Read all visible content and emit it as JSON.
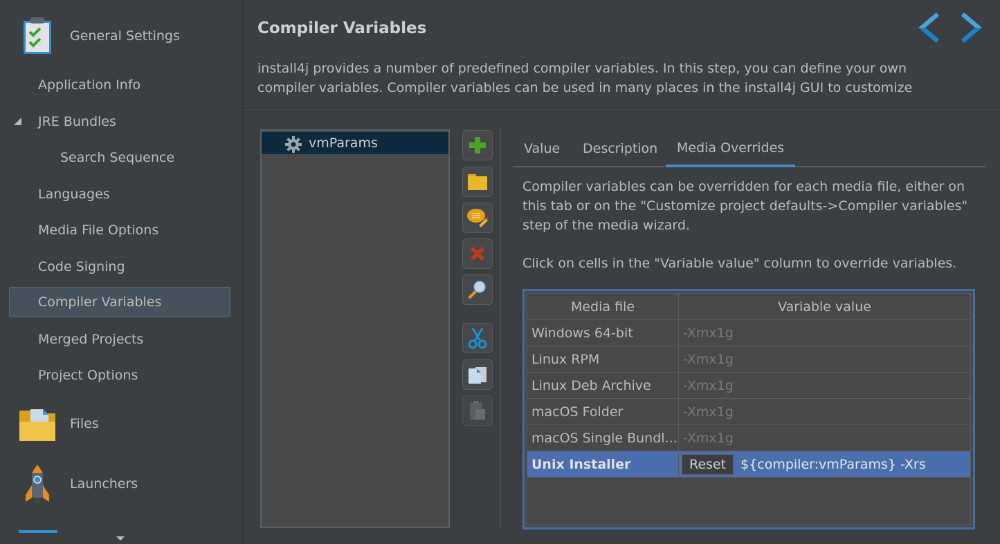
{
  "sidebar": {
    "sections": [
      {
        "label": "General Settings",
        "icon": "clipboard-check-icon"
      },
      {
        "label": "Files",
        "icon": "folder-icon"
      },
      {
        "label": "Launchers",
        "icon": "rocket-icon"
      }
    ],
    "items": [
      {
        "label": "Application Info"
      },
      {
        "label": "JRE Bundles",
        "expanded": true
      },
      {
        "label": "Search Sequence"
      },
      {
        "label": "Languages"
      },
      {
        "label": "Media File Options"
      },
      {
        "label": "Code Signing"
      },
      {
        "label": "Compiler Variables",
        "selected": true
      },
      {
        "label": "Merged Projects"
      },
      {
        "label": "Project Options"
      }
    ]
  },
  "header": {
    "title": "Compiler Variables",
    "description": "install4j provides a number of predefined compiler variables. In this step, you can define your own compiler variables. Compiler variables can be used in many places in the install4j GUI to customize",
    "nav_back_icon": "chevron-left-icon",
    "nav_forward_icon": "chevron-right-icon"
  },
  "variables": [
    {
      "name": "vmParams",
      "icon": "gear-icon",
      "selected": true
    }
  ],
  "toolbar": [
    {
      "name": "add",
      "icon": "plus-icon"
    },
    {
      "name": "add-group",
      "icon": "folder-icon"
    },
    {
      "name": "edit-description",
      "icon": "comment-edit-icon"
    },
    {
      "name": "delete",
      "icon": "delete-x-icon"
    },
    {
      "name": "find-usages",
      "icon": "magnifier-icon"
    },
    {
      "name": "cut",
      "icon": "scissors-icon"
    },
    {
      "name": "copy",
      "icon": "copy-icon"
    },
    {
      "name": "paste",
      "icon": "paste-icon",
      "disabled": true
    }
  ],
  "tabs": [
    {
      "label": "Value"
    },
    {
      "label": "Description"
    },
    {
      "label": "Media Overrides",
      "active": true
    }
  ],
  "media_overrides": {
    "info": "Compiler variables can be overridden for each media file, either on this tab or on the \"Customize project defaults->Compiler variables\" step of the media wizard.",
    "hint": "Click on cells in the \"Variable value\" column to override variables.",
    "columns": [
      "Media file",
      "Variable value"
    ],
    "rows": [
      {
        "media": "Windows 64-bit",
        "value": "-Xmx1g"
      },
      {
        "media": "Linux RPM",
        "value": "-Xmx1g"
      },
      {
        "media": "Linux Deb Archive",
        "value": "-Xmx1g"
      },
      {
        "media": "macOS Folder",
        "value": "-Xmx1g"
      },
      {
        "media": "macOS Single Bundl...",
        "value": "-Xmx1g"
      },
      {
        "media": "Unix Installer",
        "value": "${compiler:vmParams} -Xrs",
        "overridden": true,
        "selected": true
      }
    ],
    "reset_label": "Reset"
  },
  "colors": {
    "background": "#3c3f41",
    "selection": "#4b6eaf",
    "accent": "#4a88c7",
    "tree_selection": "#0d293e"
  }
}
